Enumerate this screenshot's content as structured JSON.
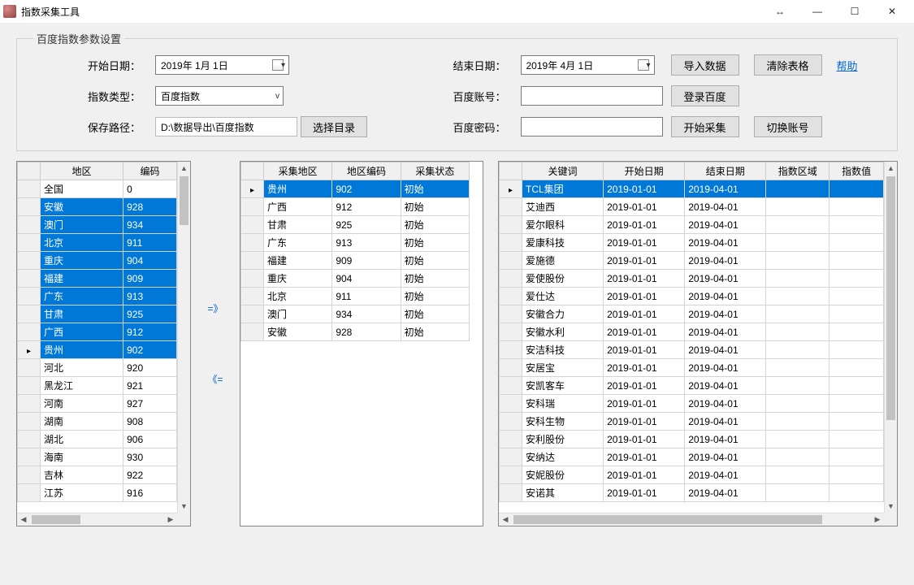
{
  "window": {
    "title": "指数采集工具"
  },
  "params": {
    "legend": "百度指数参数设置",
    "start_label": "开始日期：",
    "start_value": "2019年 1月 1日",
    "end_label": "结束日期：",
    "end_value": "2019年 4月 1日",
    "type_label": "指数类型：",
    "type_value": "百度指数",
    "account_label": "百度账号：",
    "account_value": "",
    "path_label": "保存路径：",
    "path_value": "D:\\数据导出\\百度指数",
    "password_label": "百度密码：",
    "password_value": "",
    "btn_import": "导入数据",
    "btn_clear": "清除表格",
    "btn_help": "帮助",
    "btn_login": "登录百度",
    "btn_pickdir": "选择目录",
    "btn_start": "开始采集",
    "btn_switch": "切换账号"
  },
  "transfer": {
    "right": "=》",
    "left": "《="
  },
  "grid1": {
    "headers": [
      "地区",
      "编码"
    ],
    "special_row": {
      "region": "全国",
      "code": "0"
    },
    "rows": [
      {
        "region": "安徽",
        "code": "928",
        "sel": true
      },
      {
        "region": "澳门",
        "code": "934",
        "sel": true
      },
      {
        "region": "北京",
        "code": "911",
        "sel": true
      },
      {
        "region": "重庆",
        "code": "904",
        "sel": true
      },
      {
        "region": "福建",
        "code": "909",
        "sel": true
      },
      {
        "region": "广东",
        "code": "913",
        "sel": true
      },
      {
        "region": "甘肃",
        "code": "925",
        "sel": true
      },
      {
        "region": "广西",
        "code": "912",
        "sel": true
      },
      {
        "region": "贵州",
        "code": "902",
        "sel": true,
        "cur": true
      },
      {
        "region": "河北",
        "code": "920"
      },
      {
        "region": "黑龙江",
        "code": "921"
      },
      {
        "region": "河南",
        "code": "927"
      },
      {
        "region": "湖南",
        "code": "908"
      },
      {
        "region": "湖北",
        "code": "906"
      },
      {
        "region": "海南",
        "code": "930"
      },
      {
        "region": "吉林",
        "code": "922"
      },
      {
        "region": "江苏",
        "code": "916"
      }
    ]
  },
  "grid2": {
    "headers": [
      "采集地区",
      "地区编码",
      "采集状态"
    ],
    "rows": [
      {
        "region": "贵州",
        "code": "902",
        "status": "初始",
        "sel": true,
        "cur": true
      },
      {
        "region": "广西",
        "code": "912",
        "status": "初始"
      },
      {
        "region": "甘肃",
        "code": "925",
        "status": "初始"
      },
      {
        "region": "广东",
        "code": "913",
        "status": "初始"
      },
      {
        "region": "福建",
        "code": "909",
        "status": "初始"
      },
      {
        "region": "重庆",
        "code": "904",
        "status": "初始"
      },
      {
        "region": "北京",
        "code": "911",
        "status": "初始"
      },
      {
        "region": "澳门",
        "code": "934",
        "status": "初始"
      },
      {
        "region": "安徽",
        "code": "928",
        "status": "初始"
      }
    ]
  },
  "grid3": {
    "headers": [
      "关键词",
      "开始日期",
      "结束日期",
      "指数区域",
      "指数值"
    ],
    "rows": [
      {
        "kw": "TCL集团",
        "s": "2019-01-01",
        "e": "2019-04-01",
        "a": "",
        "v": "",
        "sel": true,
        "cur": true
      },
      {
        "kw": "艾迪西",
        "s": "2019-01-01",
        "e": "2019-04-01",
        "a": "",
        "v": ""
      },
      {
        "kw": "爱尔眼科",
        "s": "2019-01-01",
        "e": "2019-04-01",
        "a": "",
        "v": ""
      },
      {
        "kw": "爱康科技",
        "s": "2019-01-01",
        "e": "2019-04-01",
        "a": "",
        "v": ""
      },
      {
        "kw": "爱施德",
        "s": "2019-01-01",
        "e": "2019-04-01",
        "a": "",
        "v": ""
      },
      {
        "kw": "爱使股份",
        "s": "2019-01-01",
        "e": "2019-04-01",
        "a": "",
        "v": ""
      },
      {
        "kw": "爱仕达",
        "s": "2019-01-01",
        "e": "2019-04-01",
        "a": "",
        "v": ""
      },
      {
        "kw": "安徽合力",
        "s": "2019-01-01",
        "e": "2019-04-01",
        "a": "",
        "v": ""
      },
      {
        "kw": "安徽水利",
        "s": "2019-01-01",
        "e": "2019-04-01",
        "a": "",
        "v": ""
      },
      {
        "kw": "安洁科技",
        "s": "2019-01-01",
        "e": "2019-04-01",
        "a": "",
        "v": ""
      },
      {
        "kw": "安居宝",
        "s": "2019-01-01",
        "e": "2019-04-01",
        "a": "",
        "v": ""
      },
      {
        "kw": "安凯客车",
        "s": "2019-01-01",
        "e": "2019-04-01",
        "a": "",
        "v": ""
      },
      {
        "kw": "安科瑞",
        "s": "2019-01-01",
        "e": "2019-04-01",
        "a": "",
        "v": ""
      },
      {
        "kw": "安科生物",
        "s": "2019-01-01",
        "e": "2019-04-01",
        "a": "",
        "v": ""
      },
      {
        "kw": "安利股份",
        "s": "2019-01-01",
        "e": "2019-04-01",
        "a": "",
        "v": ""
      },
      {
        "kw": "安纳达",
        "s": "2019-01-01",
        "e": "2019-04-01",
        "a": "",
        "v": ""
      },
      {
        "kw": "安妮股份",
        "s": "2019-01-01",
        "e": "2019-04-01",
        "a": "",
        "v": ""
      },
      {
        "kw": "安诺其",
        "s": "2019-01-01",
        "e": "2019-04-01",
        "a": "",
        "v": ""
      }
    ]
  }
}
